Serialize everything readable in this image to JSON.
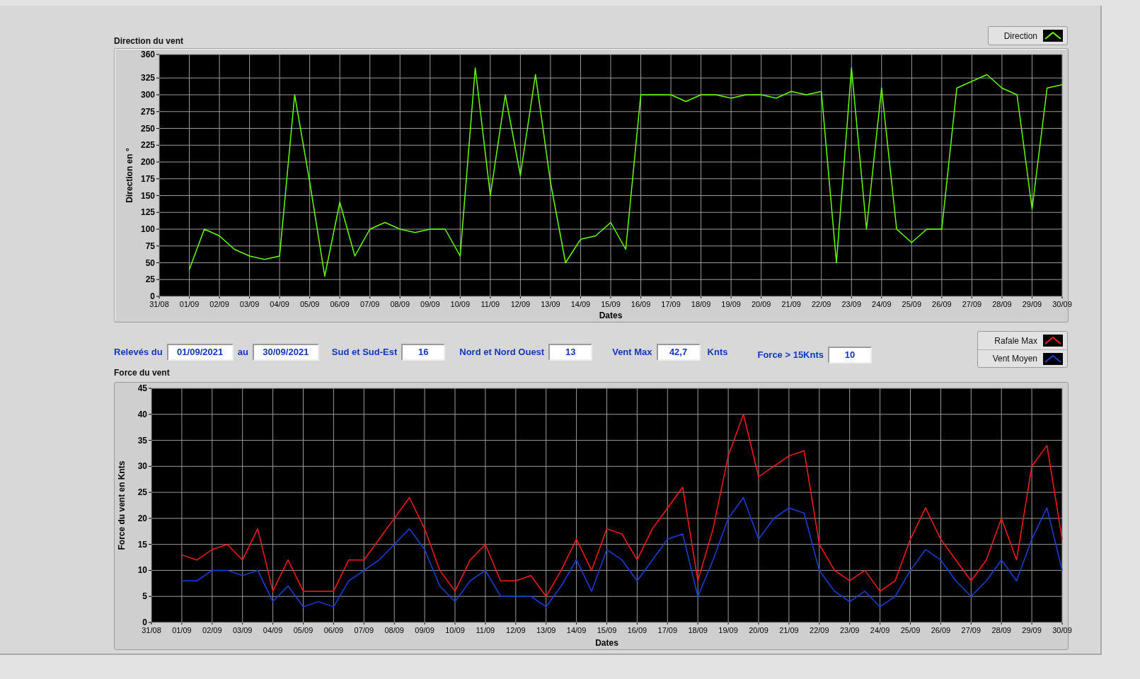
{
  "direction_chart": {
    "title": "Direction du vent",
    "chart_data": {
      "type": "line",
      "grid": true,
      "xlabel": "Dates",
      "ylabel": "Direction en °",
      "ylim": [
        0,
        360
      ],
      "categories": [
        "31/08",
        null,
        "01/09",
        null,
        "02/09",
        null,
        "03/09",
        null,
        "04/09",
        null,
        "05/09",
        null,
        "06/09",
        null,
        "07/09",
        null,
        "08/09",
        null,
        "09/09",
        null,
        "10/09",
        null,
        "11/09",
        null,
        "12/09",
        null,
        "13/09",
        null,
        "14/09",
        null,
        "15/09",
        null,
        "16/09",
        null,
        "17/09",
        null,
        "18/09",
        null,
        "19/09",
        null,
        "20/09",
        null,
        "21/09",
        null,
        "22/09",
        null,
        "23/09",
        null,
        "24/09",
        null,
        "25/09",
        null,
        "26/09",
        null,
        "27/09",
        null,
        "28/09",
        null,
        "29/09",
        null,
        "30/09"
      ],
      "yticks": [
        0,
        25,
        50,
        75,
        100,
        125,
        150,
        175,
        200,
        225,
        250,
        275,
        300,
        325,
        360
      ],
      "series": [
        {
          "name": "Direction",
          "color": "#66ff00",
          "values": [
            null,
            null,
            40,
            100,
            90,
            70,
            60,
            55,
            60,
            300,
            170,
            30,
            140,
            60,
            100,
            110,
            100,
            95,
            100,
            100,
            60,
            340,
            150,
            300,
            180,
            330,
            170,
            50,
            85,
            90,
            110,
            70,
            300,
            300,
            300,
            290,
            300,
            300,
            295,
            300,
            300,
            295,
            305,
            300,
            305,
            50,
            340,
            100,
            310,
            100,
            80,
            100,
            100,
            310,
            320,
            330,
            310,
            300,
            130,
            310,
            315
          ]
        }
      ]
    }
  },
  "controls": [
    {
      "label": "Relevés du",
      "value": "01/09/2021"
    },
    {
      "label": "au",
      "value": "30/09/2021"
    },
    {
      "label": "Sud et Sud-Est",
      "value": "16"
    },
    {
      "label": "Nord et Nord Ouest",
      "value": "13"
    },
    {
      "label": "Vent Max",
      "value": "42,7",
      "unit": "Knts"
    },
    {
      "label": "Force > 15Knts",
      "value": "10"
    }
  ],
  "force_chart": {
    "title": "Force du vent",
    "chart_data": {
      "type": "line",
      "grid": true,
      "xlabel": "Dates",
      "ylabel": "Force du vent en Knts",
      "ylim": [
        0,
        45
      ],
      "categories": [
        "31/08",
        null,
        "01/09",
        null,
        "02/09",
        null,
        "03/09",
        null,
        "04/09",
        null,
        "05/09",
        null,
        "06/09",
        null,
        "07/09",
        null,
        "08/09",
        null,
        "09/09",
        null,
        "10/09",
        null,
        "11/09",
        null,
        "12/09",
        null,
        "13/09",
        null,
        "14/09",
        null,
        "15/09",
        null,
        "16/09",
        null,
        "17/09",
        null,
        "18/09",
        null,
        "19/09",
        null,
        "20/09",
        null,
        "21/09",
        null,
        "22/09",
        null,
        "23/09",
        null,
        "24/09",
        null,
        "25/09",
        null,
        "26/09",
        null,
        "27/09",
        null,
        "28/09",
        null,
        "29/09",
        null,
        "30/09"
      ],
      "yticks": [
        0,
        5,
        10,
        15,
        20,
        25,
        30,
        35,
        40,
        45
      ],
      "series": [
        {
          "name": "Rafale Max",
          "color": "#ff1a1a",
          "values": [
            null,
            null,
            13,
            12,
            14,
            15,
            12,
            18,
            6,
            12,
            6,
            6,
            6,
            12,
            12,
            16,
            20,
            24,
            18,
            10,
            6,
            12,
            15,
            8,
            8,
            9,
            5,
            10,
            16,
            10,
            18,
            17,
            12,
            18,
            22,
            26,
            8,
            18,
            32,
            40,
            28,
            30,
            32,
            33,
            15,
            10,
            8,
            10,
            6,
            8,
            16,
            22,
            16,
            12,
            8,
            12,
            20,
            12,
            30,
            34,
            16
          ]
        },
        {
          "name": "Vent Moyen",
          "color": "#1a3fd9",
          "values": [
            null,
            null,
            8,
            8,
            10,
            10,
            9,
            10,
            4,
            7,
            3,
            4,
            3,
            8,
            10,
            12,
            15,
            18,
            14,
            7,
            4,
            8,
            10,
            5,
            5,
            5,
            3,
            7,
            12,
            6,
            14,
            12,
            8,
            12,
            16,
            17,
            5,
            12,
            20,
            24,
            16,
            20,
            22,
            21,
            10,
            6,
            4,
            6,
            3,
            5,
            10,
            14,
            12,
            8,
            5,
            8,
            12,
            8,
            16,
            22,
            10
          ]
        }
      ]
    }
  }
}
